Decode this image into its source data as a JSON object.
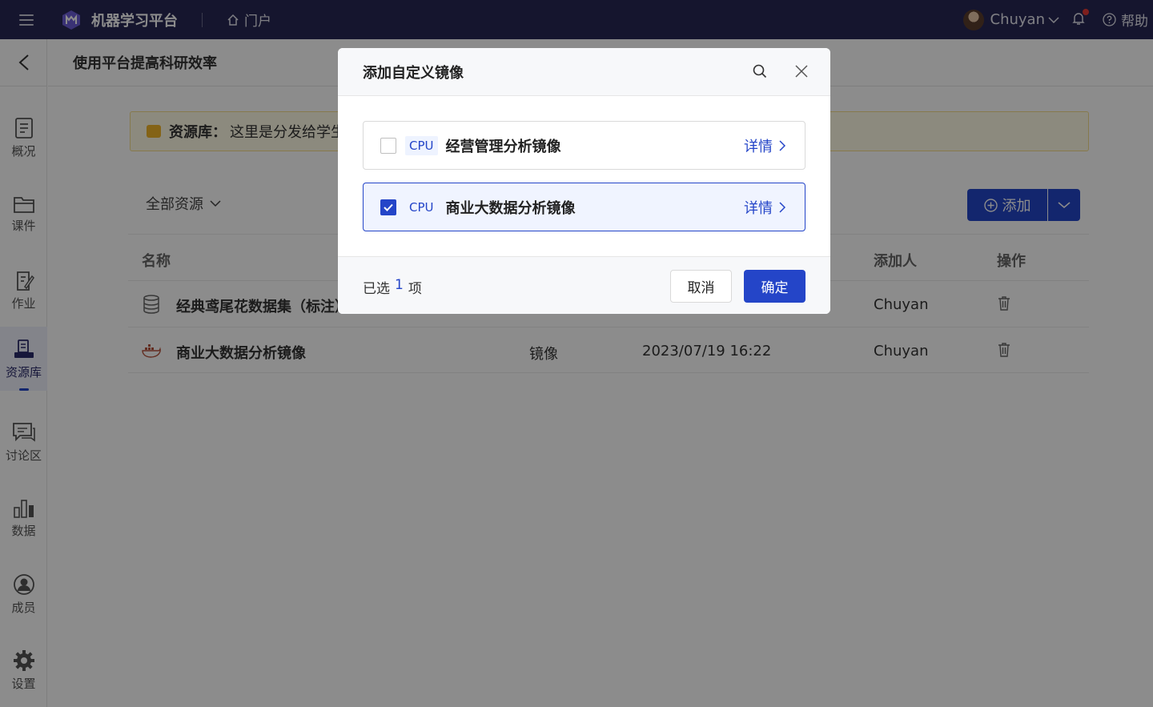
{
  "topbar": {
    "brand": "机器学习平台",
    "portal_label": "门户",
    "user_name": "Chuyan",
    "help_label": "帮助"
  },
  "page": {
    "title": "使用平台提高科研效率"
  },
  "sidebar": {
    "items": [
      {
        "label": "概况",
        "icon": "overview-icon"
      },
      {
        "label": "课件",
        "icon": "folder-icon"
      },
      {
        "label": "作业",
        "icon": "homework-icon"
      },
      {
        "label": "资源库",
        "icon": "resource-icon",
        "active": true
      },
      {
        "label": "讨论区",
        "icon": "discussion-icon"
      },
      {
        "label": "数据",
        "icon": "data-chart-icon"
      },
      {
        "label": "成员",
        "icon": "member-icon"
      },
      {
        "label": "设置",
        "icon": "gear-icon"
      }
    ]
  },
  "notice": {
    "prefix": "资源库：",
    "text": "这里是分发给学生"
  },
  "toolbar": {
    "filter_label": "全部资源",
    "add_label": "添加"
  },
  "table": {
    "headers": {
      "name": "名称",
      "adder": "添加人",
      "actions": "操作"
    },
    "rows": [
      {
        "name": "经典鸢尾花数据集（标注）",
        "type": "",
        "time": "",
        "adder": "Chuyan",
        "icon": "database-icon"
      },
      {
        "name": "商业大数据分析镜像",
        "type": "镜像",
        "time": "2023/07/19 16:22",
        "adder": "Chuyan",
        "icon": "docker-icon"
      }
    ]
  },
  "modal": {
    "title": "添加自定义镜像",
    "options": [
      {
        "tag": "CPU",
        "name": "经营管理分析镜像",
        "detail": "详情",
        "checked": false
      },
      {
        "tag": "CPU",
        "name": "商业大数据分析镜像",
        "detail": "详情",
        "checked": true
      }
    ],
    "selected_prefix": "已选",
    "selected_count": "1",
    "selected_suffix": "项",
    "cancel_label": "取消",
    "ok_label": "确定"
  },
  "colors": {
    "topbar": "#272754",
    "accent": "#2445c8",
    "overlay": "rgba(0,0,0,0.45)"
  }
}
